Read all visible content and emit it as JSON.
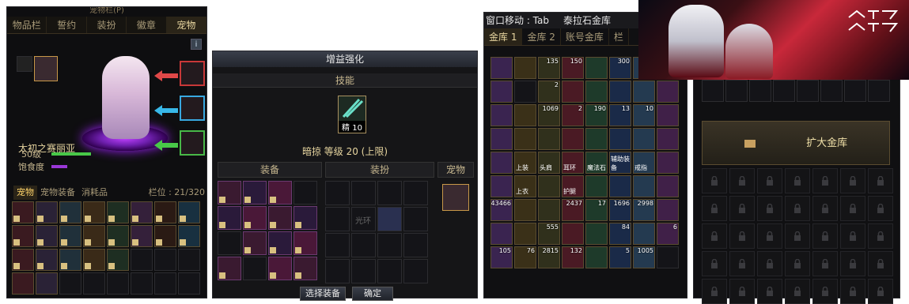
{
  "panel_pet": {
    "title": "宠物栏(P)",
    "tabs": [
      "物品栏",
      "誓约",
      "装扮",
      "徽章",
      "宠物"
    ],
    "active_tab": "宠物",
    "info_label": "i",
    "pet_name": "太初之赛丽亚",
    "pet_level": "50级",
    "satiety_label": "饱食度",
    "subtabs": [
      "宠物",
      "宠物装备",
      "消耗品"
    ],
    "slots_label": "栏位 : 21/320",
    "colors": {
      "arrow_red": "#e04848",
      "arrow_blue": "#38b8e8",
      "arrow_green": "#48c848",
      "exp_bar": "#48c848",
      "satiety_bar": "#9a38d8"
    }
  },
  "panel_enhance": {
    "title": "增益强化",
    "skill_header": "技能",
    "skill_level_badge": "精 10",
    "skill_line": "暗掠 等级 20 (上限)",
    "col_equip": "装备",
    "col_avatar": "装扮",
    "col_pet": "宠物",
    "avatar_text": "光环",
    "btn_select": "选择装备",
    "btn_confirm": "确定"
  },
  "panel_storage": {
    "title_left": "窗口移动 : Tab",
    "title": "泰拉石金库",
    "tabs": [
      "金库 1",
      "金库 2",
      "账号金库",
      "栏"
    ],
    "item_numbers": [
      "",
      "",
      "135",
      "150",
      "",
      "300",
      "",
      "",
      "",
      "",
      "2",
      "",
      "",
      "",
      "",
      "",
      "",
      "",
      "1069",
      "2",
      "190",
      "13",
      "10",
      "",
      "",
      "",
      "",
      "",
      "",
      "",
      "",
      "",
      "",
      "",
      "",
      "",
      "",
      "",
      "",
      "",
      "",
      "",
      "",
      "",
      "",
      "",
      "",
      "",
      "43466",
      "",
      "",
      "2437",
      "17",
      "1696",
      "2998",
      "",
      "",
      "",
      "555",
      "",
      "",
      "84",
      "",
      "6",
      "105",
      "76",
      "2815",
      "132",
      "",
      "5",
      "1005",
      ""
    ],
    "item_labels": [
      "",
      "",
      "",
      "",
      "",
      "",
      "",
      "",
      "",
      "",
      "",
      "",
      "",
      "",
      "",
      "",
      "",
      "",
      "",
      "",
      "",
      "",
      "",
      "",
      "",
      "",
      "",
      "",
      "",
      "",
      "",
      "",
      "",
      "上装",
      "头肩",
      "耳环",
      "魔法石",
      "辅助装备",
      "戒指",
      "",
      "",
      "上衣",
      "",
      "护腿",
      "",
      "",
      "",
      "",
      "",
      "",
      "",
      "",
      "",
      "",
      "",
      "",
      "",
      "",
      "",
      "",
      "",
      "",
      "",
      "",
      "",
      "",
      "",
      "",
      "",
      "",
      "",
      ""
    ]
  },
  "panel_expand": {
    "expand_label": "扩大金库"
  }
}
